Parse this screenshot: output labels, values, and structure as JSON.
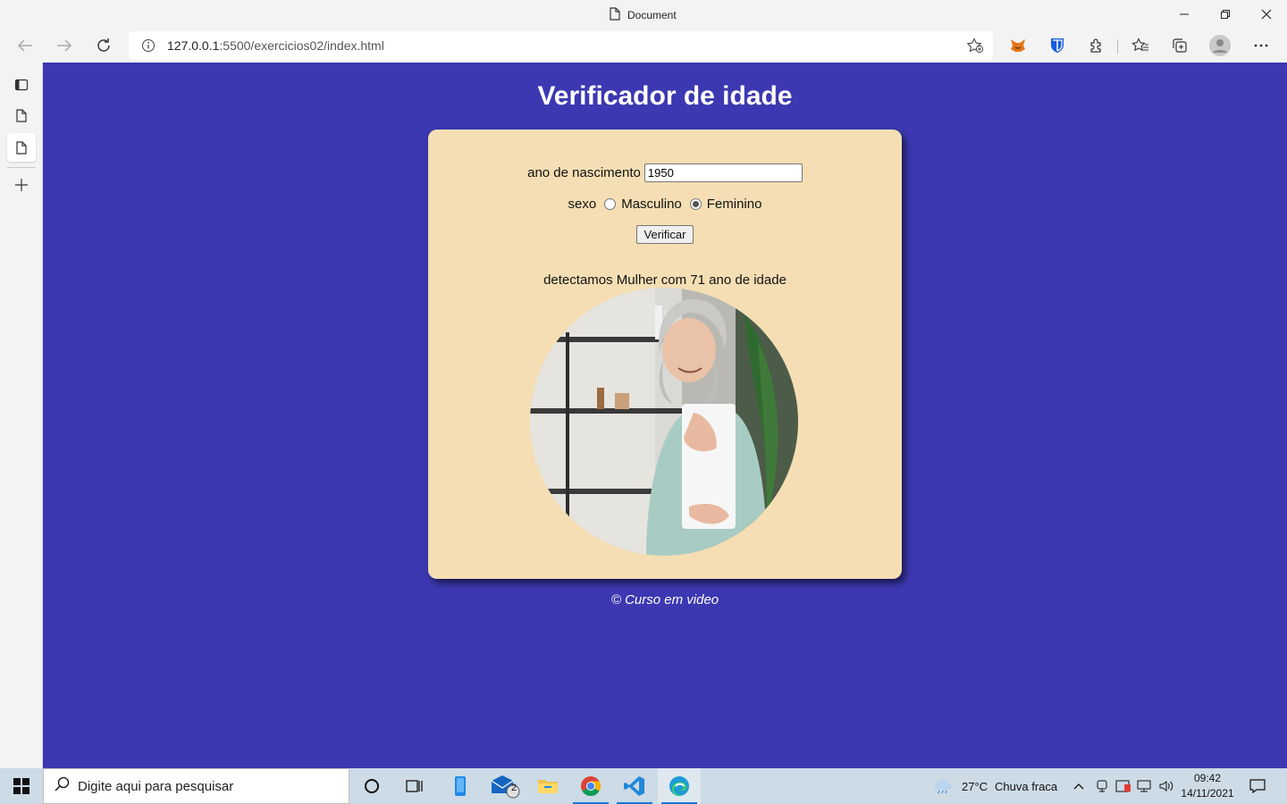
{
  "browser": {
    "window_title": "Document",
    "address_host": "127.0.0.1",
    "address_rest": ":5500/exercicios02/index.html"
  },
  "page": {
    "heading": "Verificador de idade",
    "birth_label": "ano de nascimento",
    "birth_value": "1950",
    "sex_label": "sexo",
    "option_male": "Masculino",
    "option_female": "Feminino",
    "selected_option": "Feminino",
    "verify_button": "Verificar",
    "result_text": "detectamos Mulher com 71 ano de idade",
    "footer": "© Curso em video",
    "background_color": "#3c38b1",
    "card_color": "#f5deb3"
  },
  "taskbar": {
    "search_placeholder": "Digite aqui para pesquisar",
    "mail_badge": "2",
    "temperature": "27°C",
    "weather": "Chuva fraca",
    "time": "09:42",
    "date": "14/11/2021"
  },
  "icons": [
    "document-icon",
    "minimize-icon",
    "restore-icon",
    "close-icon",
    "back-icon",
    "forward-icon",
    "refresh-icon",
    "info-icon",
    "favorite-add-icon",
    "metamask-icon",
    "bitwarden-icon",
    "extensions-icon",
    "favorites-icon",
    "collections-icon",
    "profile-icon",
    "more-icon",
    "tab-actions-icon",
    "tab-page-icon",
    "new-tab-icon",
    "windows-start-icon",
    "search-icon",
    "cortana-icon",
    "task-view-icon",
    "weather-icon"
  ]
}
